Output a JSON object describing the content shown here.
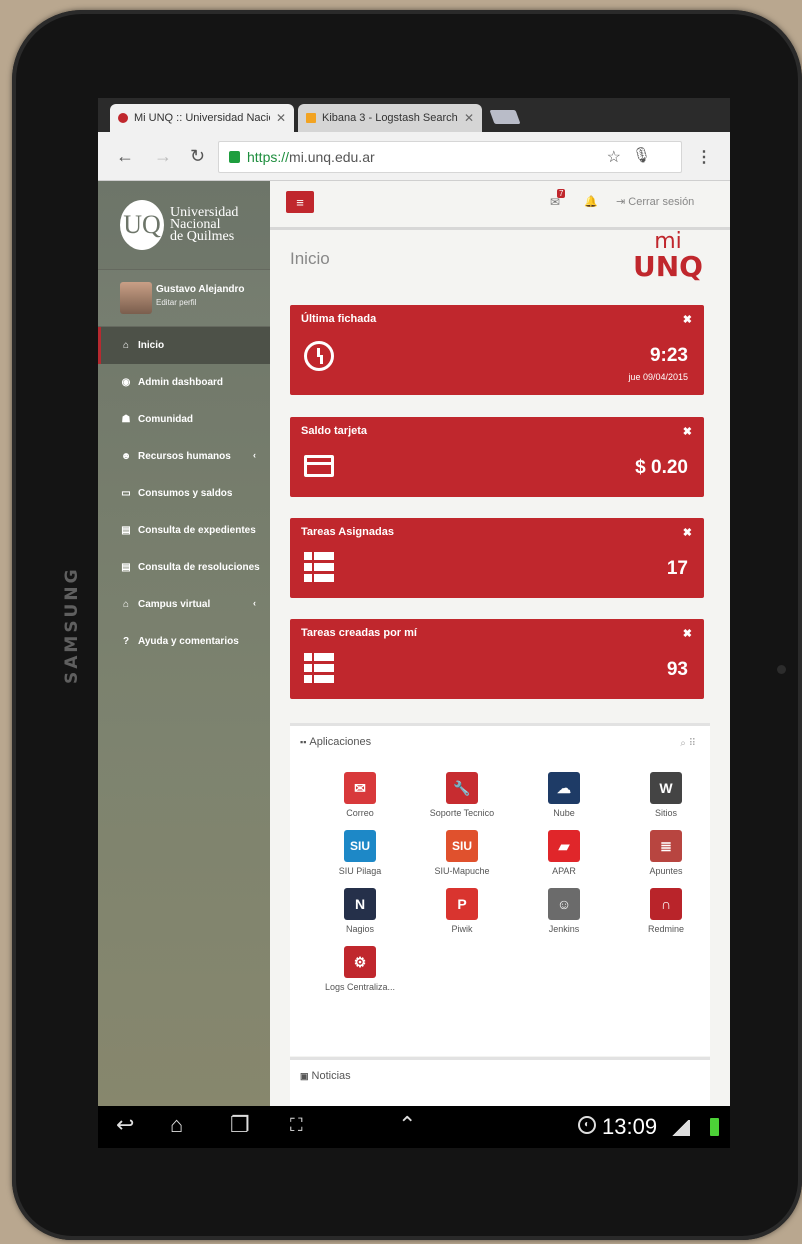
{
  "device": {
    "brand": "SAMSUNG"
  },
  "browser": {
    "tabs": [
      {
        "title": "Mi UNQ :: Universidad Nacio",
        "active": true
      },
      {
        "title": "Kibana 3 - Logstash Search",
        "active": false
      }
    ],
    "url_scheme": "https://",
    "url_host": "mi.unq.edu.ar"
  },
  "sidebar": {
    "logo_letters": "UQ",
    "logo_line1": "Universidad",
    "logo_line2": "Nacional",
    "logo_line3": "de Quilmes",
    "user_name": "Gustavo Alejandro",
    "user_edit": "Editar perfil",
    "items": [
      {
        "label": "Inicio",
        "icon": "home-icon"
      },
      {
        "label": "Admin dashboard",
        "icon": "dashboard-icon"
      },
      {
        "label": "Comunidad",
        "icon": "users-icon"
      },
      {
        "label": "Recursos humanos",
        "icon": "user-icon",
        "chev": "‹"
      },
      {
        "label": "Consumos y saldos",
        "icon": "card-icon"
      },
      {
        "label": "Consulta de expedientes",
        "icon": "file-icon"
      },
      {
        "label": "Consulta de resoluciones",
        "icon": "file-icon"
      },
      {
        "label": "Campus virtual",
        "icon": "graduation-icon",
        "chev": "‹"
      },
      {
        "label": "Ayuda y comentarios",
        "icon": "help-icon"
      }
    ]
  },
  "topbar": {
    "mail_count": "7",
    "logout_label": "Cerrar sesión"
  },
  "main": {
    "title": "Inicio",
    "brand_mi": "mi",
    "brand_unq": "UNQ",
    "cards": [
      {
        "title": "Última fichada",
        "value": "9:23",
        "sub": "jue 09/04/2015"
      },
      {
        "title": "Saldo tarjeta",
        "value": "$ 0.20"
      },
      {
        "title": "Tareas Asignadas",
        "value": "17"
      },
      {
        "title": "Tareas creadas por mí",
        "value": "93"
      }
    ],
    "apps_title": "Aplicaciones",
    "apps": [
      {
        "label": "Correo",
        "icon": "mail-icon",
        "glyph": "✉",
        "color": "#d8393b"
      },
      {
        "label": "Soporte Tecnico",
        "icon": "wrench-icon",
        "glyph": "🔧",
        "color": "#c72c30"
      },
      {
        "label": "Nube",
        "icon": "cloud-icon",
        "glyph": "☁",
        "color": "#1e3b66"
      },
      {
        "label": "Sitios",
        "icon": "wordpress-icon",
        "glyph": "W",
        "color": "#444444"
      },
      {
        "label": "SIU Pilaga",
        "icon": "siu-pilaga-icon",
        "glyph": "SIU",
        "color": "#1d88c7"
      },
      {
        "label": "SIU-Mapuche",
        "icon": "siu-mapuche-icon",
        "glyph": "SIU",
        "color": "#e0512d"
      },
      {
        "label": "APAR",
        "icon": "folder-icon",
        "glyph": "▰",
        "color": "#e0262a"
      },
      {
        "label": "Apuntes",
        "icon": "notes-icon",
        "glyph": "≣",
        "color": "#b84540"
      },
      {
        "label": "Nagios",
        "icon": "nagios-icon",
        "glyph": "N",
        "color": "#25304a"
      },
      {
        "label": "Piwik",
        "icon": "piwik-icon",
        "glyph": "P",
        "color": "#d9342f"
      },
      {
        "label": "Jenkins",
        "icon": "jenkins-icon",
        "glyph": "☺",
        "color": "#6b6b6b"
      },
      {
        "label": "Redmine",
        "icon": "redmine-icon",
        "glyph": "∩",
        "color": "#b9242a"
      },
      {
        "label": "Logs Centraliza...",
        "icon": "gear-icon",
        "glyph": "⚙",
        "color": "#c0272d"
      }
    ],
    "news_title": "Noticias"
  },
  "statusbar": {
    "time": "13:09"
  }
}
